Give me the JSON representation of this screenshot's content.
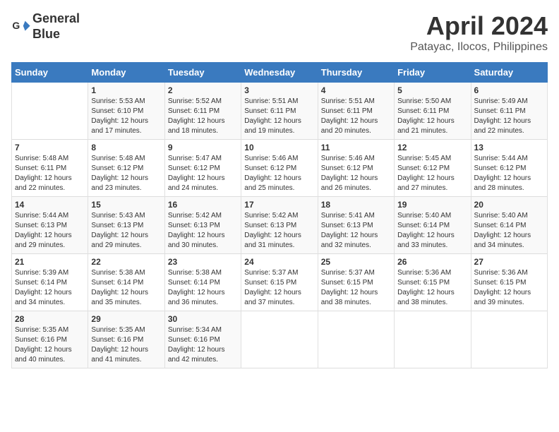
{
  "header": {
    "logo_line1": "General",
    "logo_line2": "Blue",
    "month_year": "April 2024",
    "location": "Patayac, Ilocos, Philippines"
  },
  "days_of_week": [
    "Sunday",
    "Monday",
    "Tuesday",
    "Wednesday",
    "Thursday",
    "Friday",
    "Saturday"
  ],
  "weeks": [
    [
      {
        "num": "",
        "info": ""
      },
      {
        "num": "1",
        "info": "Sunrise: 5:53 AM\nSunset: 6:10 PM\nDaylight: 12 hours\nand 17 minutes."
      },
      {
        "num": "2",
        "info": "Sunrise: 5:52 AM\nSunset: 6:11 PM\nDaylight: 12 hours\nand 18 minutes."
      },
      {
        "num": "3",
        "info": "Sunrise: 5:51 AM\nSunset: 6:11 PM\nDaylight: 12 hours\nand 19 minutes."
      },
      {
        "num": "4",
        "info": "Sunrise: 5:51 AM\nSunset: 6:11 PM\nDaylight: 12 hours\nand 20 minutes."
      },
      {
        "num": "5",
        "info": "Sunrise: 5:50 AM\nSunset: 6:11 PM\nDaylight: 12 hours\nand 21 minutes."
      },
      {
        "num": "6",
        "info": "Sunrise: 5:49 AM\nSunset: 6:11 PM\nDaylight: 12 hours\nand 22 minutes."
      }
    ],
    [
      {
        "num": "7",
        "info": "Sunrise: 5:48 AM\nSunset: 6:11 PM\nDaylight: 12 hours\nand 22 minutes."
      },
      {
        "num": "8",
        "info": "Sunrise: 5:48 AM\nSunset: 6:12 PM\nDaylight: 12 hours\nand 23 minutes."
      },
      {
        "num": "9",
        "info": "Sunrise: 5:47 AM\nSunset: 6:12 PM\nDaylight: 12 hours\nand 24 minutes."
      },
      {
        "num": "10",
        "info": "Sunrise: 5:46 AM\nSunset: 6:12 PM\nDaylight: 12 hours\nand 25 minutes."
      },
      {
        "num": "11",
        "info": "Sunrise: 5:46 AM\nSunset: 6:12 PM\nDaylight: 12 hours\nand 26 minutes."
      },
      {
        "num": "12",
        "info": "Sunrise: 5:45 AM\nSunset: 6:12 PM\nDaylight: 12 hours\nand 27 minutes."
      },
      {
        "num": "13",
        "info": "Sunrise: 5:44 AM\nSunset: 6:12 PM\nDaylight: 12 hours\nand 28 minutes."
      }
    ],
    [
      {
        "num": "14",
        "info": "Sunrise: 5:44 AM\nSunset: 6:13 PM\nDaylight: 12 hours\nand 29 minutes."
      },
      {
        "num": "15",
        "info": "Sunrise: 5:43 AM\nSunset: 6:13 PM\nDaylight: 12 hours\nand 29 minutes."
      },
      {
        "num": "16",
        "info": "Sunrise: 5:42 AM\nSunset: 6:13 PM\nDaylight: 12 hours\nand 30 minutes."
      },
      {
        "num": "17",
        "info": "Sunrise: 5:42 AM\nSunset: 6:13 PM\nDaylight: 12 hours\nand 31 minutes."
      },
      {
        "num": "18",
        "info": "Sunrise: 5:41 AM\nSunset: 6:13 PM\nDaylight: 12 hours\nand 32 minutes."
      },
      {
        "num": "19",
        "info": "Sunrise: 5:40 AM\nSunset: 6:14 PM\nDaylight: 12 hours\nand 33 minutes."
      },
      {
        "num": "20",
        "info": "Sunrise: 5:40 AM\nSunset: 6:14 PM\nDaylight: 12 hours\nand 34 minutes."
      }
    ],
    [
      {
        "num": "21",
        "info": "Sunrise: 5:39 AM\nSunset: 6:14 PM\nDaylight: 12 hours\nand 34 minutes."
      },
      {
        "num": "22",
        "info": "Sunrise: 5:38 AM\nSunset: 6:14 PM\nDaylight: 12 hours\nand 35 minutes."
      },
      {
        "num": "23",
        "info": "Sunrise: 5:38 AM\nSunset: 6:14 PM\nDaylight: 12 hours\nand 36 minutes."
      },
      {
        "num": "24",
        "info": "Sunrise: 5:37 AM\nSunset: 6:15 PM\nDaylight: 12 hours\nand 37 minutes."
      },
      {
        "num": "25",
        "info": "Sunrise: 5:37 AM\nSunset: 6:15 PM\nDaylight: 12 hours\nand 38 minutes."
      },
      {
        "num": "26",
        "info": "Sunrise: 5:36 AM\nSunset: 6:15 PM\nDaylight: 12 hours\nand 38 minutes."
      },
      {
        "num": "27",
        "info": "Sunrise: 5:36 AM\nSunset: 6:15 PM\nDaylight: 12 hours\nand 39 minutes."
      }
    ],
    [
      {
        "num": "28",
        "info": "Sunrise: 5:35 AM\nSunset: 6:16 PM\nDaylight: 12 hours\nand 40 minutes."
      },
      {
        "num": "29",
        "info": "Sunrise: 5:35 AM\nSunset: 6:16 PM\nDaylight: 12 hours\nand 41 minutes."
      },
      {
        "num": "30",
        "info": "Sunrise: 5:34 AM\nSunset: 6:16 PM\nDaylight: 12 hours\nand 42 minutes."
      },
      {
        "num": "",
        "info": ""
      },
      {
        "num": "",
        "info": ""
      },
      {
        "num": "",
        "info": ""
      },
      {
        "num": "",
        "info": ""
      }
    ]
  ]
}
